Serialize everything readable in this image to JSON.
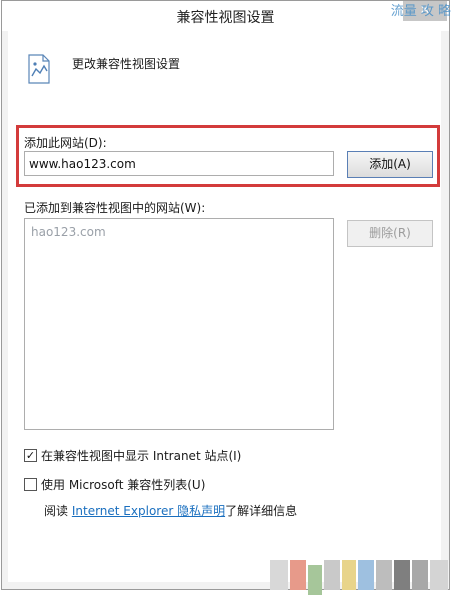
{
  "window": {
    "title": "兼容性视图设置",
    "close_glyph": "✕",
    "watermark": "流量 攻 略"
  },
  "heading": "更改兼容性视图设置",
  "add_section": {
    "label": "添加此网站(D):",
    "input_value": "www.hao123.com",
    "add_button": "添加(A)"
  },
  "list_section": {
    "label": "已添加到兼容性视图中的网站(W):",
    "items": [
      "hao123.com"
    ],
    "remove_button": "删除(R)"
  },
  "options": {
    "intranet": {
      "label": "在兼容性视图中显示 Intranet 站点(I)",
      "checked": true,
      "check_glyph": "✓"
    },
    "ms_list": {
      "label": "使用 Microsoft 兼容性列表(U)",
      "checked": false
    }
  },
  "info": {
    "prefix": "阅读",
    "link": "Internet Explorer 隐私声明",
    "suffix": "了解详细信息"
  },
  "colors": {
    "highlight_border": "#d33b3b",
    "link": "#1a6fbf"
  }
}
